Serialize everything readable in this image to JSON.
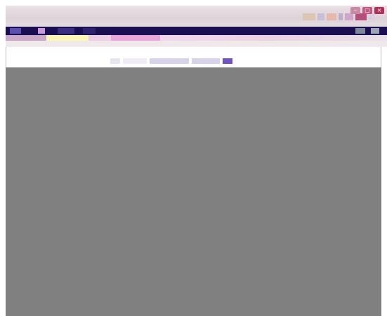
{
  "top_title": "",
  "app": {
    "title": ""
  },
  "colors": {
    "navbar": "#1a0f52",
    "pinkbar": "#f3d7ec",
    "overlay": "#808080",
    "accent_button": "#6f52c9",
    "active_tab": "#f2e79c"
  },
  "navbar": {
    "items": []
  },
  "tabs": [
    {
      "label": "",
      "active": false
    },
    {
      "label": "",
      "active": true
    }
  ],
  "breadcrumb": "",
  "toolbar": {
    "items": []
  },
  "icons": {
    "window_buttons": [
      "minimize-icon",
      "maximize-icon",
      "close-icon"
    ]
  }
}
